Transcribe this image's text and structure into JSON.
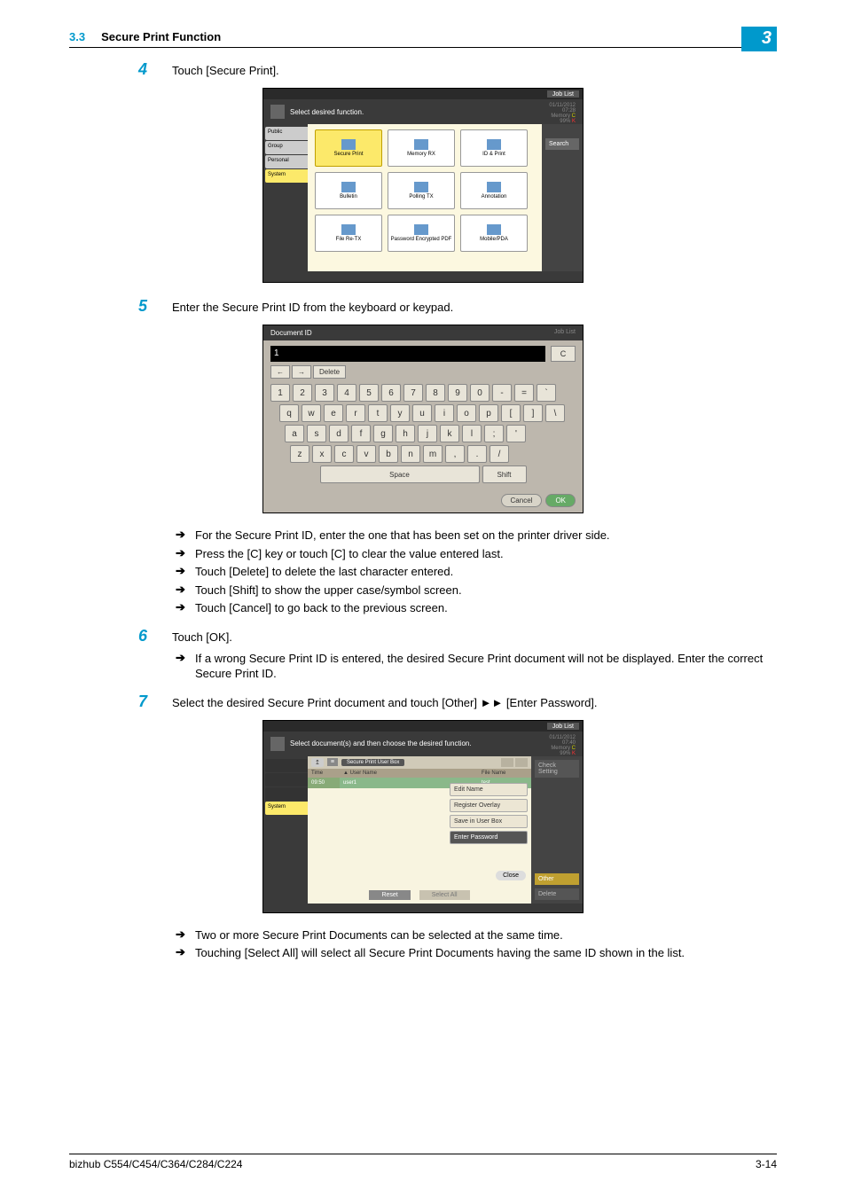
{
  "header": {
    "section_number": "3.3",
    "section_title": "Secure Print Function",
    "chapter": "3"
  },
  "steps": {
    "s4": {
      "num": "4",
      "text": "Touch [Secure Print]."
    },
    "s5": {
      "num": "5",
      "text": "Enter the Secure Print ID from the keyboard or keypad."
    },
    "s6": {
      "num": "6",
      "text": "Touch [OK]."
    },
    "s7": {
      "num": "7",
      "text": "Select the desired Secure Print document and touch [Other] ►► [Enter Password]."
    }
  },
  "bullets5": {
    "b1": "For the Secure Print ID, enter the one that has been set on the printer driver side.",
    "b2": "Press the [C] key or touch [C] to clear the value entered last.",
    "b3": "Touch [Delete] to delete the last character entered.",
    "b4": "Touch [Shift] to show the upper case/symbol screen.",
    "b5": "Touch [Cancel] to go back to the previous screen."
  },
  "bullets6": {
    "b1": "If a wrong Secure Print ID is entered, the desired Secure Print document will not be displayed. Enter the correct Secure Print ID."
  },
  "bullets8": {
    "b1": "Two or more Secure Print Documents can be selected at the same time.",
    "b2": "Touching [Select All] will select all Secure Print Documents having the same ID shown in the list."
  },
  "ui1": {
    "joblist": "Job List",
    "instruction": "Select desired function.",
    "date": "01/11/2012",
    "time": "07:28",
    "memory": "Memory",
    "mempct": "99%",
    "tabs": {
      "public": "Public",
      "group": "Group",
      "personal": "Personal",
      "system": "System"
    },
    "cells": {
      "secure_print": "Secure Print",
      "memory_rx": "Memory RX",
      "id_print": "ID & Print",
      "bulletin": "Bulletin",
      "polling_tx": "Polling TX",
      "annotation": "Annotation",
      "file_retx": "File Re-TX",
      "pwd_enc_pdf": "Password Encrypted PDF",
      "mobile_pda": "Mobile/PDA"
    },
    "search": "Search"
  },
  "ui2": {
    "title": "Document ID",
    "joblist": "Job List",
    "input_value": "1",
    "c": "C",
    "arrow_left": "←",
    "arrow_right": "→",
    "delete": "Delete",
    "row1": [
      "1",
      "2",
      "3",
      "4",
      "5",
      "6",
      "7",
      "8",
      "9",
      "0",
      "-",
      "=",
      "`"
    ],
    "row2": [
      "q",
      "w",
      "e",
      "r",
      "t",
      "y",
      "u",
      "i",
      "o",
      "p",
      "[",
      "]",
      "\\"
    ],
    "row3": [
      "a",
      "s",
      "d",
      "f",
      "g",
      "h",
      "j",
      "k",
      "l",
      ";",
      "'"
    ],
    "row4": [
      "z",
      "x",
      "c",
      "v",
      "b",
      "n",
      "m",
      ",",
      ".",
      "/"
    ],
    "space": "Space",
    "shift": "Shift",
    "cancel": "Cancel",
    "ok": "OK"
  },
  "ui3": {
    "joblist": "Job List",
    "instruction": "Select document(s) and then choose the desired function.",
    "date": "01/11/2012",
    "time": "07:40",
    "memory": "Memory",
    "mempct": "99%",
    "system_tab": "System",
    "box_label": "Secure Print User Box",
    "hdr_time": "Time",
    "hdr_user": "User Name",
    "hdr_file": "File Name",
    "row_time": "09:50",
    "row_user": "user1",
    "row_file": "test",
    "popup": {
      "edit_name": "Edit Name",
      "register_overlay": "Register Overlay",
      "save_box": "Save in User Box",
      "enter_password": "Enter Password"
    },
    "close": "Close",
    "reset": "Reset",
    "select_all": "Select All",
    "check_setting": "Check Setting",
    "other": "Other",
    "delete": "Delete"
  },
  "footer": {
    "model": "bizhub C554/C454/C364/C284/C224",
    "page": "3-14"
  }
}
